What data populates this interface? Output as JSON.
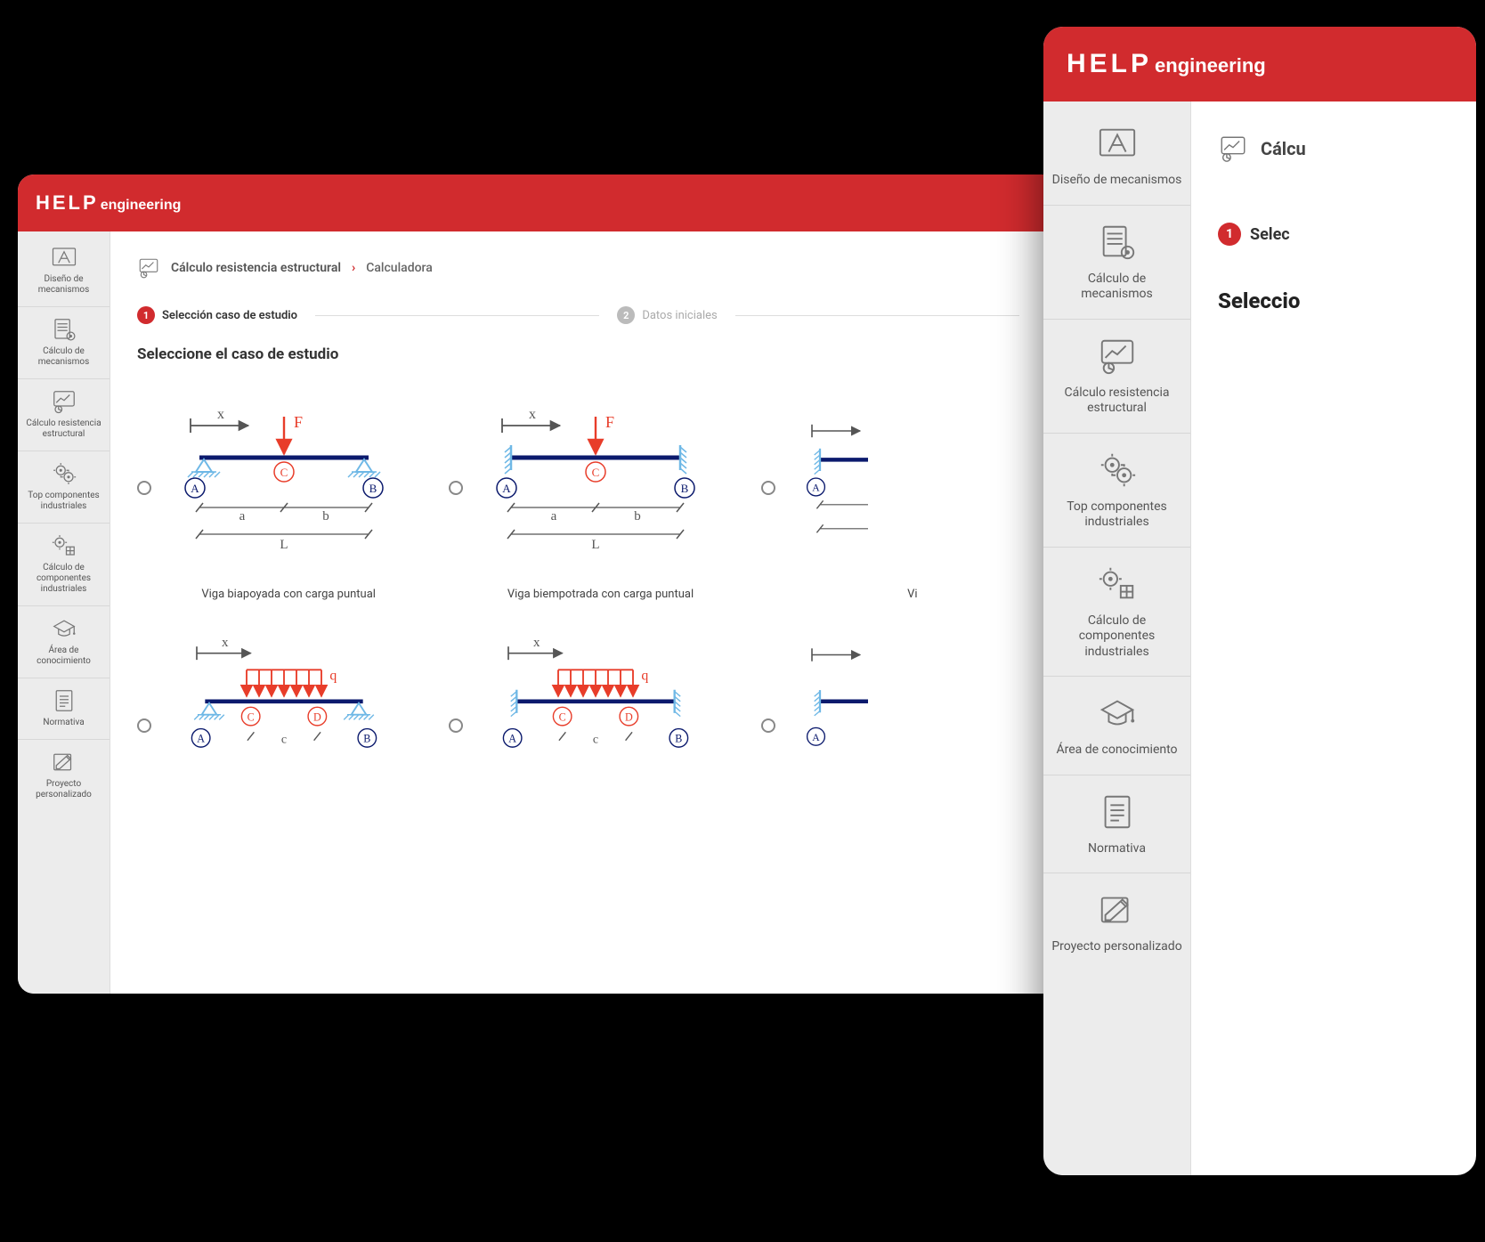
{
  "brand": {
    "help": "HELP",
    "eng": "engineering"
  },
  "sidebar": {
    "items": [
      {
        "label": "Diseño de mecanismos",
        "icon": "compass-icon"
      },
      {
        "label": "Cálculo de mecanismos",
        "icon": "calc-gear-icon"
      },
      {
        "label": "Cálculo resistencia estructural",
        "icon": "chart-icon"
      },
      {
        "label": "Top componentes industriales",
        "icon": "gears-icon"
      },
      {
        "label": "Cálculo de componentes industriales",
        "icon": "gear-grid-icon"
      },
      {
        "label": "Área de conocimiento",
        "icon": "graduation-icon"
      },
      {
        "label": "Normativa",
        "icon": "document-icon"
      },
      {
        "label": "Proyecto personalizado",
        "icon": "pencil-doc-icon"
      }
    ]
  },
  "breadcrumb": {
    "parent": "Cálculo resistencia estructural",
    "current": "Calculadora",
    "overlay_parent": "Cálcu"
  },
  "stepper": {
    "step1_num": "1",
    "step1_label": "Selección caso de estudio",
    "step2_num": "2",
    "step2_label": "Datos iniciales",
    "overlay_step1_label": "Selec"
  },
  "section": {
    "title": "Seleccione el caso de estudio",
    "overlay_title": "Seleccio"
  },
  "beam_labels": {
    "F": "F",
    "x": "x",
    "q": "q",
    "A": "A",
    "B": "B",
    "C": "C",
    "D": "D",
    "a": "a",
    "b": "b",
    "c": "c",
    "L": "L",
    "vi_partial": "Vi"
  },
  "cases": [
    {
      "caption": "Viga biapoyada con carga puntual"
    },
    {
      "caption": "Viga biempotrada con carga puntual"
    },
    {
      "caption": ""
    },
    {
      "caption": ""
    },
    {
      "caption": ""
    },
    {
      "caption": ""
    }
  ]
}
